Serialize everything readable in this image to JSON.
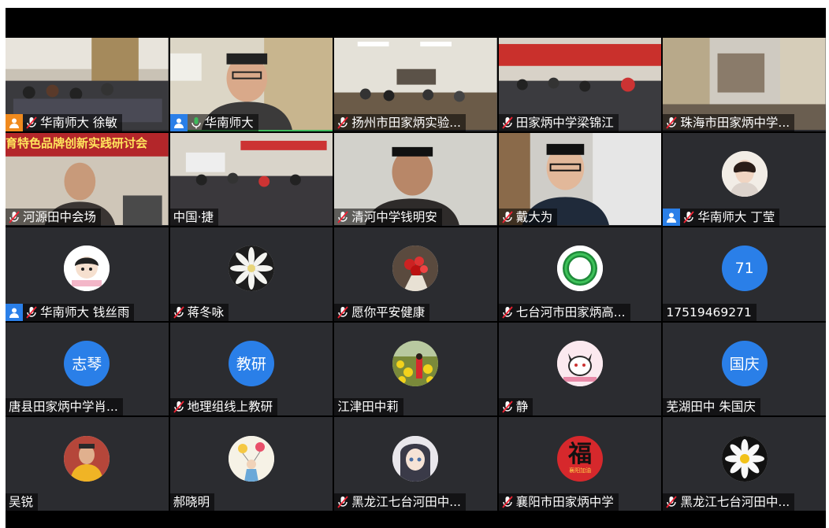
{
  "tiles": [
    {
      "name": "华南师大 徐敏",
      "host": "orange",
      "mic": "muted",
      "scene": "classroom-a"
    },
    {
      "name": "华南师大",
      "host": "blue",
      "mic": "active",
      "scene": "speaker-glasses",
      "active": true
    },
    {
      "name": "扬州市田家炳实验...",
      "mic": "muted",
      "scene": "hall-a"
    },
    {
      "name": "田家炳中学梁锦江",
      "mic": "muted",
      "scene": "hall-b"
    },
    {
      "name": "珠海市田家炳中学...",
      "mic": "muted",
      "scene": "room-curtain"
    },
    {
      "name": "河源田中会场",
      "mic": "muted",
      "scene": "banner-man",
      "banner": "育特色品牌创新实践研讨会"
    },
    {
      "name": "中国·捷",
      "scene": "hall-c"
    },
    {
      "name": "清河中学钱明安",
      "mic": "muted",
      "scene": "man-center"
    },
    {
      "name": "戴大为",
      "mic": "muted",
      "scene": "man-glasses"
    },
    {
      "name": "华南师大 丁莹",
      "host": "blue",
      "mic": "muted",
      "avatar": "portrait"
    },
    {
      "name": "华南师大 钱丝雨",
      "host": "blue",
      "mic": "muted",
      "avatar": "cartoon"
    },
    {
      "name": "蒋冬咏",
      "mic": "muted",
      "avatar": "flower-white"
    },
    {
      "name": "愿你平安健康",
      "mic": "muted",
      "avatar": "flowers-red"
    },
    {
      "name": "七台河市田家炳高...",
      "mic": "muted",
      "avatar": "ring-green"
    },
    {
      "name": "17519469271",
      "avatar_text": "71"
    },
    {
      "name": "唐县田家炳中学肖...",
      "avatar_text": "志琴"
    },
    {
      "name": "地理组线上教研",
      "mic": "muted",
      "avatar_text": "教研"
    },
    {
      "name": "江津田中莉",
      "avatar": "field-yellow"
    },
    {
      "name": "静",
      "mic": "muted",
      "avatar": "cartoon-cat"
    },
    {
      "name": "芜湖田中 朱国庆",
      "avatar_text": "国庆"
    },
    {
      "name": "吴锐",
      "avatar": "man-yellow"
    },
    {
      "name": "郝晓明",
      "avatar": "balloons"
    },
    {
      "name": "黑龙江七台河田中...",
      "mic": "muted",
      "avatar": "anime-girl"
    },
    {
      "name": "襄阳市田家炳中学",
      "mic": "muted",
      "avatar": "fu",
      "avatar_text": "福",
      "avatar_sub": "襄阳加油"
    },
    {
      "name": "黑龙江七台河田中...",
      "mic": "muted",
      "avatar": "daisy"
    }
  ],
  "colors": {
    "tile_bg": "#2b2c30",
    "host_orange": "#f08a1e",
    "host_blue": "#2a7fe8",
    "avatar_blue": "#2a7fe8",
    "active_green": "#3dba5b"
  }
}
